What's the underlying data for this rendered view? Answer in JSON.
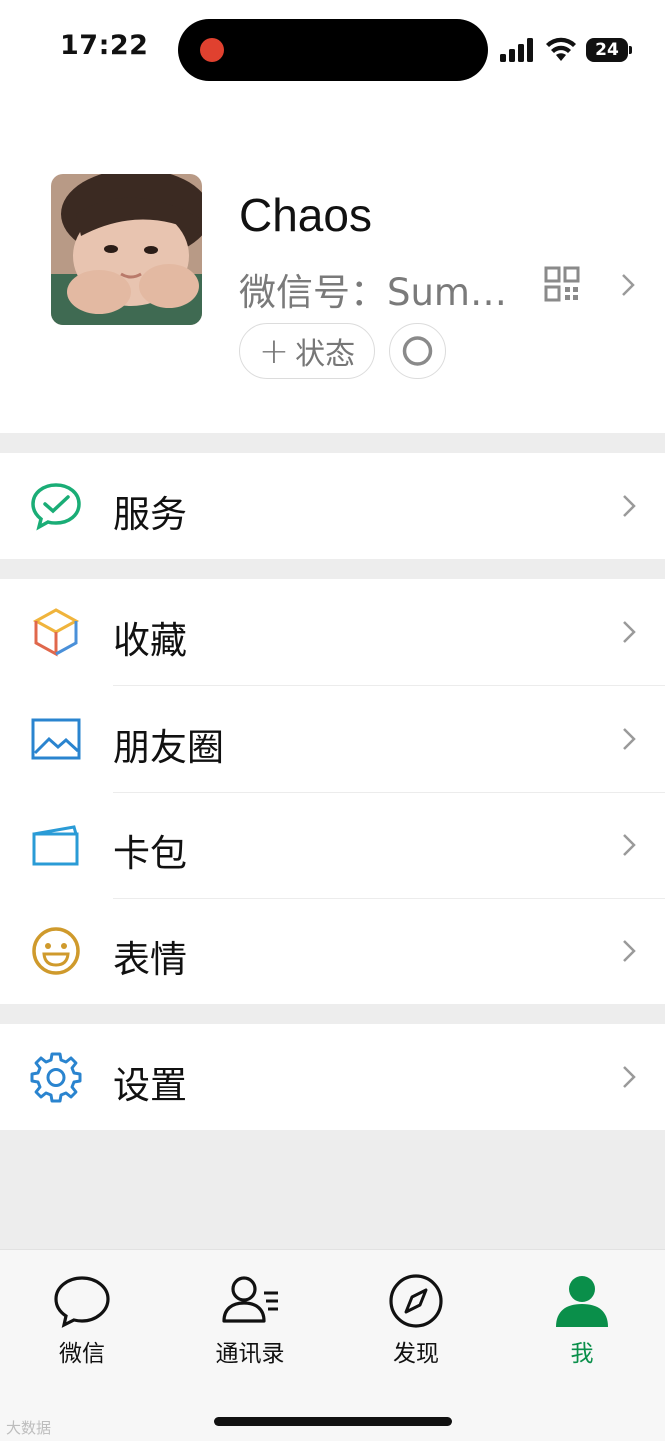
{
  "status_bar": {
    "time": "17:22",
    "battery": "24"
  },
  "profile": {
    "nickname": "Chaos",
    "wechat_id": "微信号：Sum…",
    "status_button_label": "状态",
    "status_button_plus": "+"
  },
  "menu": {
    "services": {
      "label": "服务",
      "icon": "wechat-pay-check-icon"
    },
    "favorites": {
      "label": "收藏",
      "icon": "cube-icon"
    },
    "moments": {
      "label": "朋友圈",
      "icon": "picture-icon"
    },
    "cards": {
      "label": "卡包",
      "icon": "card-icon"
    },
    "stickers": {
      "label": "表情",
      "icon": "smile-icon"
    },
    "settings": {
      "label": "设置",
      "icon": "gear-icon"
    }
  },
  "tabs": [
    {
      "label": "微信",
      "icon": "chat-bubble-icon",
      "active": false
    },
    {
      "label": "通讯录",
      "icon": "contacts-icon",
      "active": false
    },
    {
      "label": "发现",
      "icon": "compass-icon",
      "active": false
    },
    {
      "label": "我",
      "icon": "person-icon",
      "active": true
    }
  ],
  "colors": {
    "accent_green": "#07c160",
    "active_tab": "#0a8f4a",
    "background": "#ededed",
    "recording_dot": "#e0412f"
  },
  "watermark": "大数据"
}
